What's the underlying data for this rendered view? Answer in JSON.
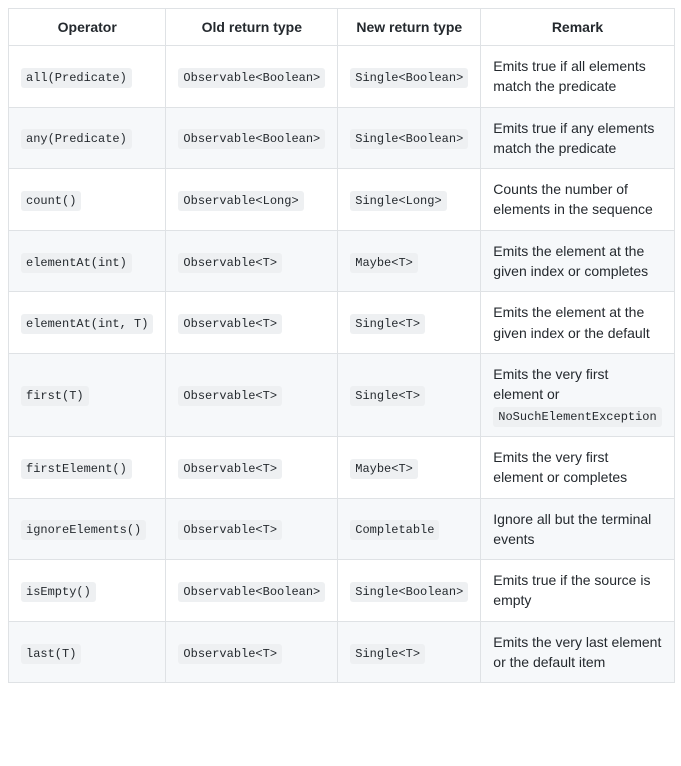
{
  "headers": {
    "operator": "Operator",
    "old": "Old return type",
    "new": "New return type",
    "remark": "Remark"
  },
  "rows": [
    {
      "operator": "all(Predicate)",
      "old": "Observable<Boolean>",
      "new": "Single<Boolean>",
      "remark_text": "Emits true if all elements match the predicate",
      "remark_code": ""
    },
    {
      "operator": "any(Predicate)",
      "old": "Observable<Boolean>",
      "new": "Single<Boolean>",
      "remark_text": "Emits true if any elements match the predicate",
      "remark_code": ""
    },
    {
      "operator": "count()",
      "old": "Observable<Long>",
      "new": "Single<Long>",
      "remark_text": "Counts the number of elements in the sequence",
      "remark_code": ""
    },
    {
      "operator": "elementAt(int)",
      "old": "Observable<T>",
      "new": "Maybe<T>",
      "remark_text": "Emits the element at the given index or completes",
      "remark_code": ""
    },
    {
      "operator": "elementAt(int, T)",
      "old": "Observable<T>",
      "new": "Single<T>",
      "remark_text": "Emits the element at the given index or the default",
      "remark_code": ""
    },
    {
      "operator": "first(T)",
      "old": "Observable<T>",
      "new": "Single<T>",
      "remark_text": "Emits the very first element or ",
      "remark_code": "NoSuchElementException"
    },
    {
      "operator": "firstElement()",
      "old": "Observable<T>",
      "new": "Maybe<T>",
      "remark_text": "Emits the very first element or completes",
      "remark_code": ""
    },
    {
      "operator": "ignoreElements()",
      "old": "Observable<T>",
      "new": "Completable",
      "remark_text": "Ignore all but the terminal events",
      "remark_code": ""
    },
    {
      "operator": "isEmpty()",
      "old": "Observable<Boolean>",
      "new": "Single<Boolean>",
      "remark_text": "Emits true if the source is empty",
      "remark_code": ""
    },
    {
      "operator": "last(T)",
      "old": "Observable<T>",
      "new": "Single<T>",
      "remark_text": "Emits the very last element or the default item",
      "remark_code": ""
    }
  ]
}
